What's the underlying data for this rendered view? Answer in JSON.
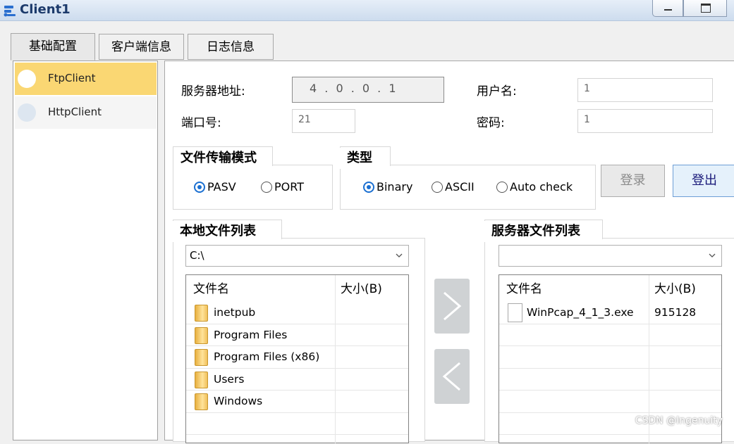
{
  "window": {
    "title": "Client1"
  },
  "tabs": [
    "基础配置",
    "客户端信息",
    "日志信息"
  ],
  "sidebar": {
    "items": [
      "FtpClient",
      "HttpClient"
    ]
  },
  "form": {
    "server_address_label": "服务器地址:",
    "server_address_value": "4 . 0 . 0 . 1",
    "username_label": "用户名:",
    "username_value": "1",
    "port_label": "端口号:",
    "port_value": "21",
    "password_label": "密码:",
    "password_value": "1"
  },
  "transfer_mode": {
    "title": "文件传输模式",
    "options": [
      "PASV",
      "PORT"
    ],
    "selected": "PASV"
  },
  "type": {
    "title": "类型",
    "options": [
      "Binary",
      "ASCII",
      "Auto check"
    ],
    "selected": "Binary"
  },
  "buttons": {
    "login": "登录",
    "logout": "登出"
  },
  "local": {
    "title": "本地文件列表",
    "path": "C:\\",
    "columns": [
      "文件名",
      "大小(B)"
    ],
    "rows": [
      {
        "name": "inetpub",
        "size": ""
      },
      {
        "name": "Program Files",
        "size": ""
      },
      {
        "name": "Program Files (x86)",
        "size": ""
      },
      {
        "name": "Users",
        "size": ""
      },
      {
        "name": "Windows",
        "size": ""
      }
    ]
  },
  "server": {
    "title": "服务器文件列表",
    "path": "",
    "columns": [
      "文件名",
      "大小(B)"
    ],
    "rows": [
      {
        "name": "WinPcap_4_1_3.exe",
        "size": "915128"
      }
    ]
  },
  "watermark": "CSDN @Ingenuity",
  "colors": {
    "selected_item": "#fad773",
    "accent": "#1a6fd1",
    "title_text": "#1c3a6b"
  }
}
